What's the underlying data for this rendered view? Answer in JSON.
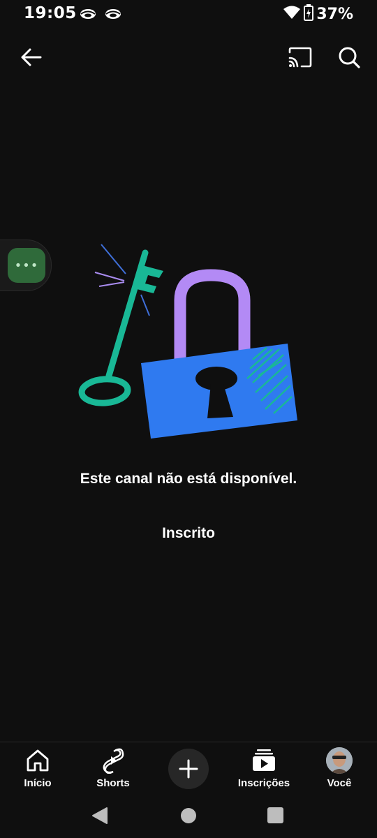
{
  "status": {
    "time": "19:05",
    "battery": "37%",
    "left_icons": [
      "notification-eye-icon",
      "notification-eye-icon"
    ],
    "right_icons": [
      "wifi-icon",
      "battery-charging-icon"
    ]
  },
  "top_bar": {
    "icons": [
      "back-arrow-icon",
      "cast-icon",
      "search-icon"
    ]
  },
  "floating_bubble": {
    "glyph": "•••"
  },
  "main": {
    "message": "Este canal não está disponível.",
    "subscribed_label": "Inscrito"
  },
  "bottom_nav": {
    "items": [
      {
        "label": "Início",
        "icon": "home-icon"
      },
      {
        "label": "Shorts",
        "icon": "shorts-icon"
      },
      {
        "label": "",
        "icon": "create-plus-icon"
      },
      {
        "label": "Inscrições",
        "icon": "subscriptions-icon"
      },
      {
        "label": "Você",
        "icon": "avatar"
      }
    ]
  },
  "colors": {
    "background": "#0f0f0f",
    "key": "#19b896",
    "shackle": "#b38af5",
    "lock_body": "#2f7af0",
    "bubble": "#2f6a3a"
  }
}
